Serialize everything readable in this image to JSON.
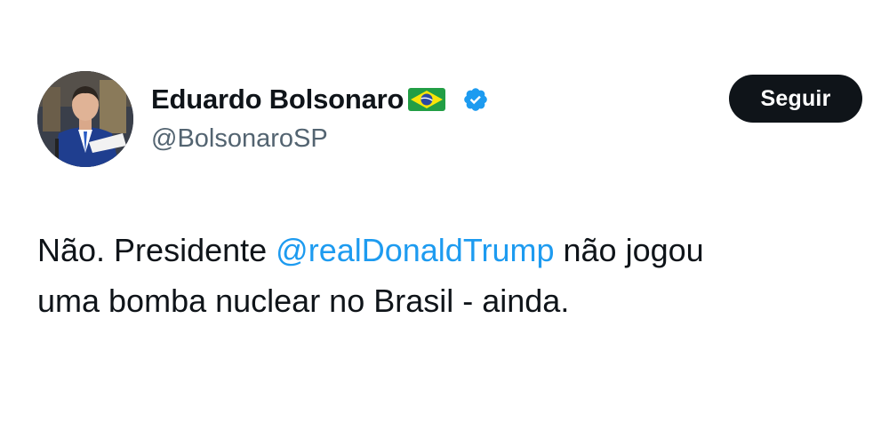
{
  "author": {
    "display_name": "Eduardo Bolsonaro",
    "handle": "@BolsonaroSP",
    "flag_icon": "brazil-flag-icon",
    "verified_icon": "verified-badge-icon",
    "verified_color": "#1d9bf0"
  },
  "follow_button": {
    "label": "Seguir"
  },
  "tweet": {
    "text_part1": "Não. Presidente ",
    "mention": "@realDonaldTrump",
    "text_part2": " não jogou",
    "text_line2": "uma bomba nuclear no Brasil - ainda."
  },
  "colors": {
    "text": "#0f1419",
    "secondary": "#536471",
    "link": "#1d9bf0",
    "button_bg": "#0f1419"
  }
}
